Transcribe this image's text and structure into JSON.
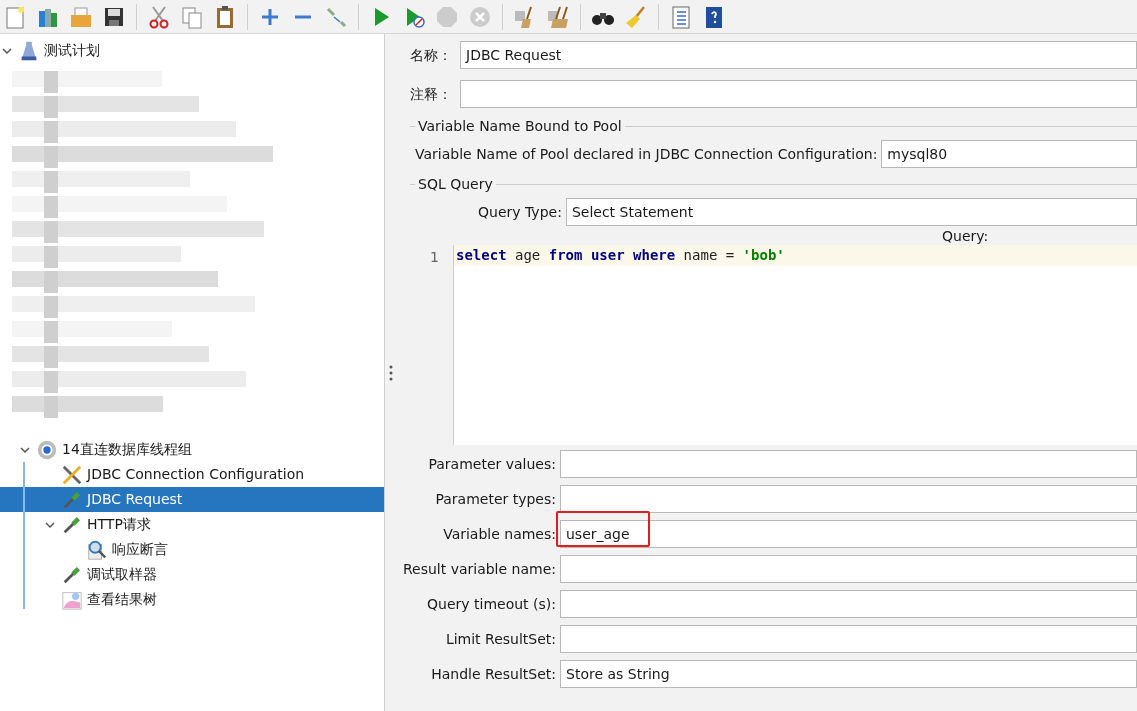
{
  "tree": {
    "label": "测试计划",
    "kind": "plan",
    "expanded": true,
    "children": [
      {
        "label": "14直连数据库线程组",
        "kind": "thread_group",
        "expanded": true,
        "selected": false,
        "children": [
          {
            "label": "JDBC Connection Configuration",
            "kind": "config",
            "selected": false
          },
          {
            "label": "JDBC Request",
            "kind": "sampler",
            "selected": true
          },
          {
            "label": "HTTP请求",
            "kind": "sampler",
            "selected": false,
            "expanded": true,
            "children": [
              {
                "label": "响应断言",
                "kind": "assertion",
                "selected": false
              }
            ]
          },
          {
            "label": "调试取样器",
            "kind": "sampler",
            "selected": false
          },
          {
            "label": "查看结果树",
            "kind": "listener",
            "selected": false
          }
        ]
      }
    ]
  },
  "form": {
    "name_label": "名称：",
    "name_value": "JDBC Request",
    "comment_label": "注释：",
    "pool_section": "Variable Name Bound to Pool",
    "pool_label": "Variable Name of Pool declared in JDBC Connection Configuration:",
    "pool_value": "mysql80",
    "sql_section": "SQL Query",
    "query_type_label": "Query Type:",
    "query_type_value": "Select Statement",
    "query_label": "Query:",
    "line_number": "1",
    "query_tokens": [
      {
        "text": "select",
        "kind": "keyword"
      },
      {
        "text": " age ",
        "kind": "plain"
      },
      {
        "text": "from user where",
        "kind": "keyword"
      },
      {
        "text": " name = ",
        "kind": "plain"
      },
      {
        "text": "'bob'",
        "kind": "string"
      }
    ],
    "fields": [
      {
        "label": "Parameter values:",
        "highlighted": false
      },
      {
        "label": "Parameter types:",
        "highlighted": false
      },
      {
        "label": "Variable names:",
        "value": "user_age",
        "highlighted": true
      },
      {
        "label": "Result variable name:",
        "highlighted": false
      },
      {
        "label": "Query timeout (s):",
        "highlighted": false
      },
      {
        "label": "Limit ResultSet:",
        "highlighted": false
      },
      {
        "label": "Handle ResultSet:",
        "value": "Store as String",
        "highlighted": false
      }
    ]
  }
}
